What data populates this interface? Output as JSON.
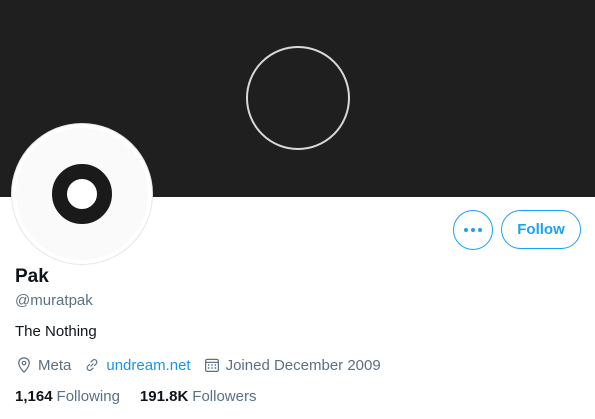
{
  "profile": {
    "name": "Pak",
    "handle": "@muratpak",
    "bio": "The Nothing",
    "location": "Meta",
    "website": "undream.net",
    "joined": "Joined December 2009"
  },
  "actions": {
    "more_icon": "more-dots-icon",
    "follow_label": "Follow"
  },
  "stats": {
    "following_count": "1,164",
    "following_label": "Following",
    "followers_count": "191.8K",
    "followers_label": "Followers"
  },
  "icons": {
    "location": "location-pin-icon",
    "link": "link-icon",
    "calendar": "calendar-icon"
  },
  "colors": {
    "accent": "#1da1f2",
    "banner": "#1f1f1f",
    "secondary_text": "#5b7083"
  }
}
